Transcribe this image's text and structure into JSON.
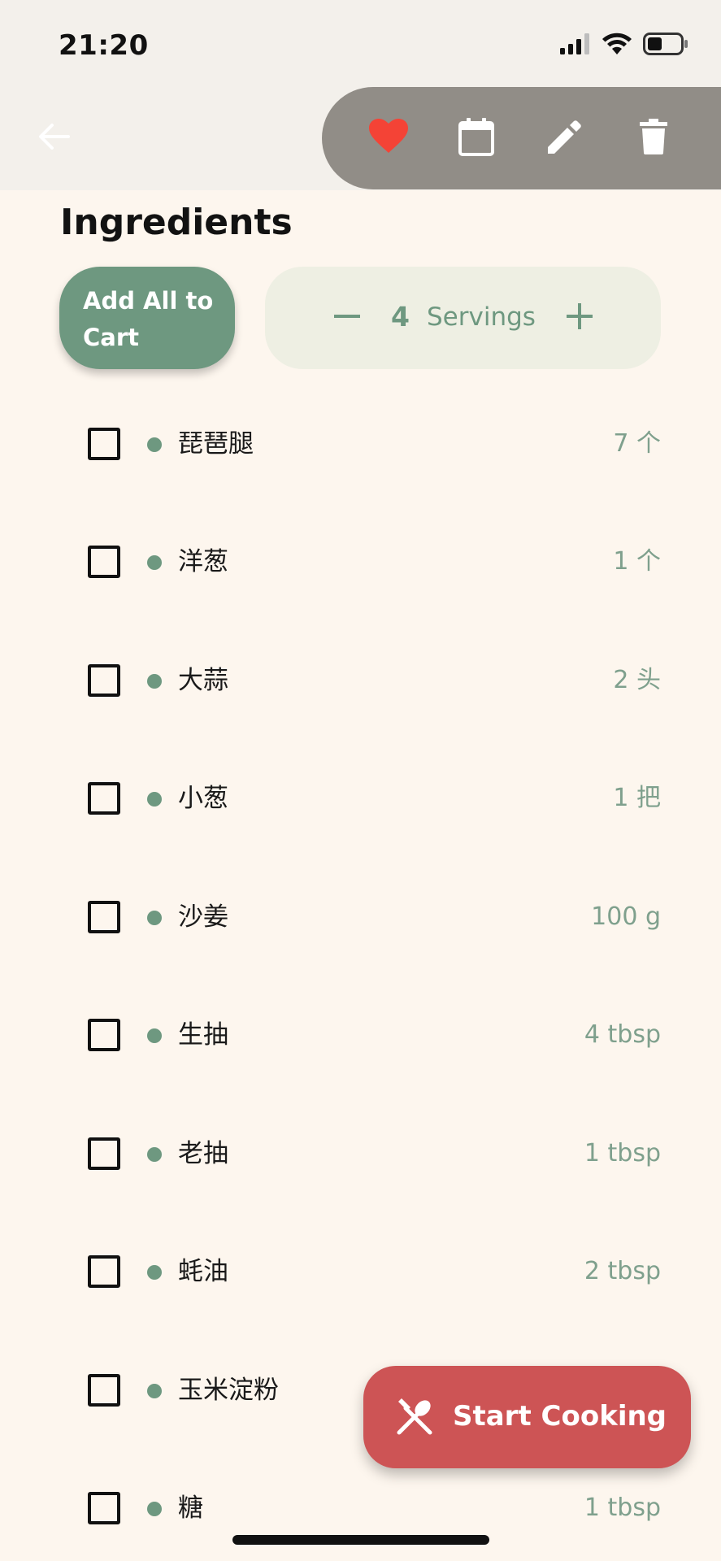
{
  "status_bar": {
    "time": "21:20"
  },
  "app_bar": {
    "icons": [
      "back-arrow-icon",
      "heart-icon",
      "calendar-icon",
      "edit-icon",
      "delete-icon"
    ],
    "favorite_color": "#F44336",
    "pill_color": "#918D87"
  },
  "ingredients": {
    "title": "Ingredients",
    "add_all_line1": "Add All to",
    "add_all_line2": "Cart",
    "servings_count": "4",
    "servings_label": "Servings",
    "items": [
      {
        "name": "琵琶腿",
        "qty": "7 个"
      },
      {
        "name": "洋葱",
        "qty": "1 个"
      },
      {
        "name": "大蒜",
        "qty": "2 头"
      },
      {
        "name": "小葱",
        "qty": "1 把"
      },
      {
        "name": "沙姜",
        "qty": "100 g"
      },
      {
        "name": "生抽",
        "qty": "4 tbsp"
      },
      {
        "name": "老抽",
        "qty": "1 tbsp"
      },
      {
        "name": "蚝油",
        "qty": "2 tbsp"
      },
      {
        "name": "玉米淀粉",
        "qty": ""
      },
      {
        "name": "糖",
        "qty": "1 tbsp"
      }
    ]
  },
  "fab": {
    "label": "Start Cooking"
  },
  "colors": {
    "accent_green": "#6E9880",
    "cooking_red": "#CD5455",
    "background": "#FDF6EE"
  }
}
